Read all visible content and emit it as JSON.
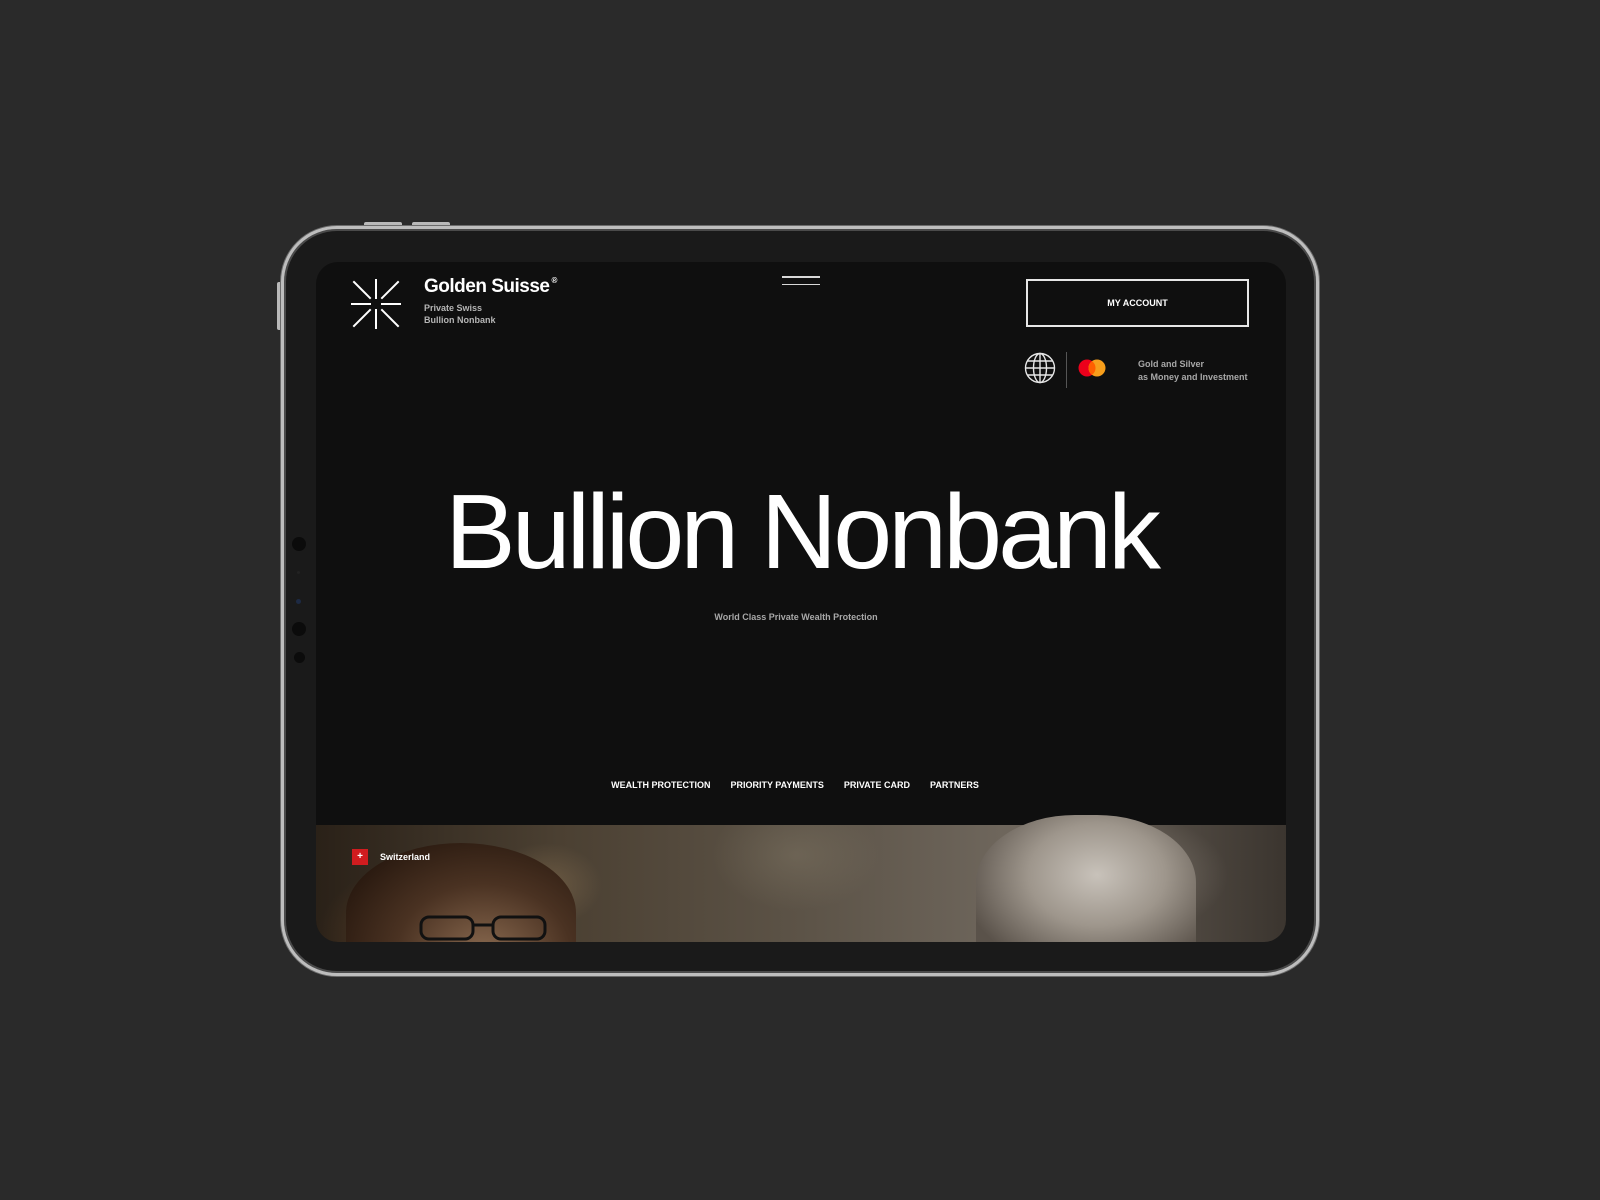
{
  "brand": {
    "name": "Golden Suisse",
    "registered": "®",
    "subtitle_line1": "Private Swiss",
    "subtitle_line2": "Bullion Nonbank"
  },
  "header": {
    "menu_icon": "hamburger-icon",
    "account_button": "MY ACCOUNT",
    "globe_icon": "globe-icon",
    "card_icon": "mastercard-icon",
    "tagline_line1": "Gold and Silver",
    "tagline_line2": "as Money and Investment"
  },
  "hero": {
    "title": "Bullion Nonbank",
    "subtitle": "World Class Private Wealth Protection"
  },
  "nav": {
    "items": [
      {
        "label": "WEALTH PROTECTION"
      },
      {
        "label": "PRIORITY PAYMENTS"
      },
      {
        "label": "PRIVATE CARD"
      },
      {
        "label": "PARTNERS"
      }
    ]
  },
  "media": {
    "flag_symbol": "+",
    "location": "Switzerland"
  },
  "colors": {
    "page_background": "#2a2a2a",
    "screen_background": "#0f0f0f",
    "text_primary": "#ffffff",
    "text_secondary": "#a8a8a8",
    "swiss_red": "#d01c1f",
    "mastercard_red": "#eb001b",
    "mastercard_orange": "#f79e1b"
  }
}
